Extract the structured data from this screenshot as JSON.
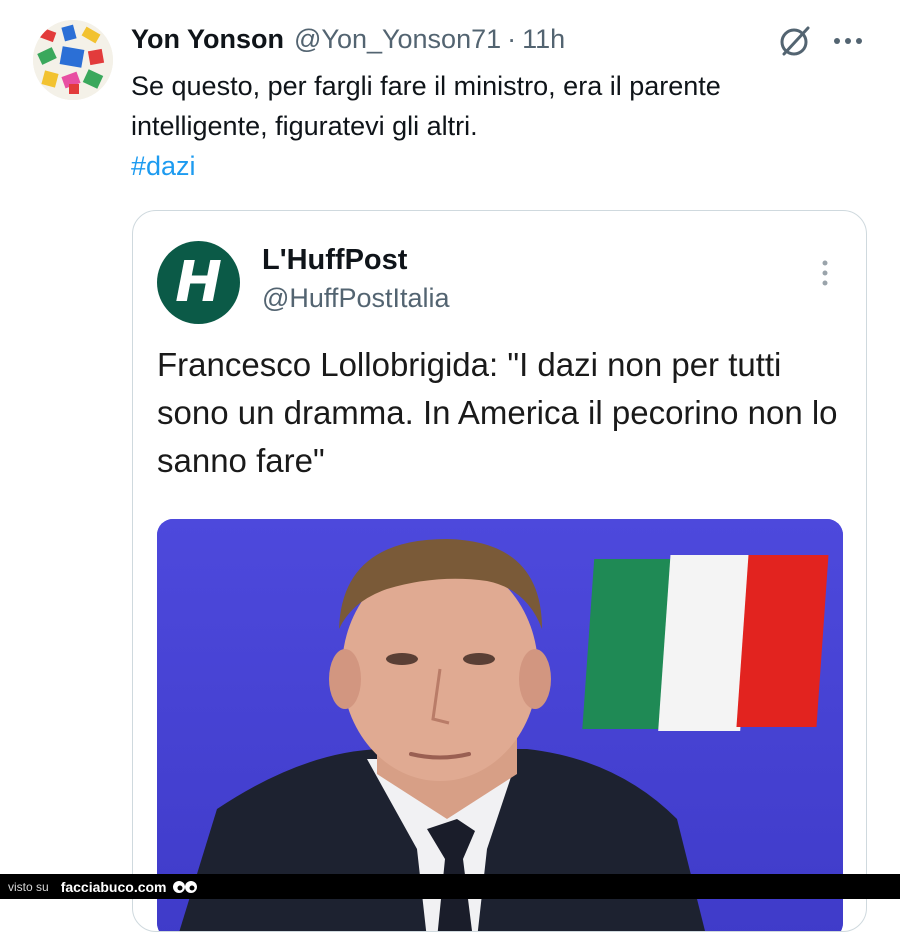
{
  "tweet": {
    "author_name": "Yon Yonson",
    "handle": "@Yon_Yonson71",
    "separator": "·",
    "time": "11h",
    "text": "Se questo, per fargli fare il ministro, era il parente intelligente, figuratevi gli altri.",
    "hashtag": "#dazi",
    "icons": {
      "grok": "grok-icon",
      "more": "more-dots-icon"
    },
    "hashtag_color": "#1d9bf0"
  },
  "quote": {
    "source_name": "L'HuffPost",
    "source_handle": "@HuffPostItalia",
    "logo_letter": "H",
    "logo_color": "#0b5a47",
    "headline": "Francesco Lollobrigida: \"I dazi non per tutti sono un dramma. In America il pecorino non lo sanno fare\""
  },
  "footer": {
    "prefix": "visto su",
    "site": "facciabuco.com"
  }
}
